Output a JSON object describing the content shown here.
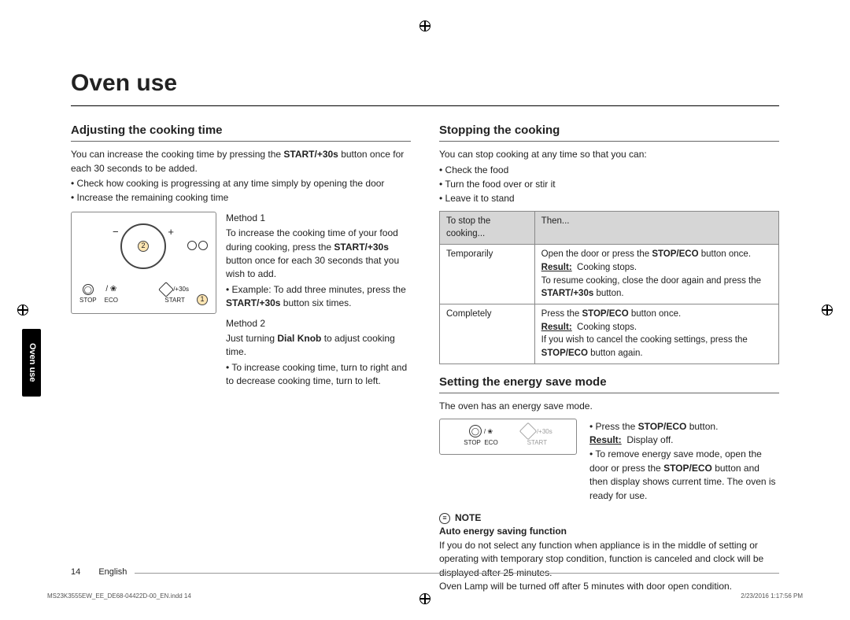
{
  "page_title": "Oven use",
  "side_tab": "Oven use",
  "left": {
    "heading": "Adjusting the cooking time",
    "intro_a": "You can increase the cooking time by pressing the ",
    "intro_bold": "START/+30s",
    "intro_b": " button once for each 30 seconds to be added.",
    "bullets": [
      "Check how cooking is progressing at any time simply by opening the door",
      "Increase the remaining cooking time"
    ],
    "diagram": {
      "stop_label": "STOP",
      "eco_label": "ECO",
      "start_label": "START",
      "plus30": "/+30s",
      "num1": "1",
      "num2": "2"
    },
    "m1_title": "Method 1",
    "m1_a": "To increase the cooking time of your food during cooking, press the ",
    "m1_bold1": "START/+30s",
    "m1_b": " button once for each 30 seconds that you wish to add.",
    "m1_ex_a": "Example: To add three minutes, press the ",
    "m1_ex_bold": "START/+30s",
    "m1_ex_b": " button six times.",
    "m2_title": "Method 2",
    "m2_a": "Just turning ",
    "m2_bold": "Dial Knob",
    "m2_b": " to adjust cooking time.",
    "m2_bullet": "To increase cooking time, turn to right and to decrease cooking time, turn to left."
  },
  "right": {
    "stop_heading": "Stopping the cooking",
    "stop_intro": "You can stop cooking at any time so that you can:",
    "stop_bullets": [
      "Check the food",
      "Turn the food over or stir it",
      "Leave it to stand"
    ],
    "th1": "To stop the cooking...",
    "th2": "Then...",
    "r1c1": "Temporarily",
    "r1_a": "Open the door or press the ",
    "r1_bold1": "STOP/ECO",
    "r1_b": " button once.",
    "result_label": "Result:",
    "r1_result": "Cooking stops.",
    "r1_c": "To resume cooking, close the door again and press the ",
    "r1_bold2": "START/+30s",
    "r1_d": " button.",
    "r2c1": "Completely",
    "r2_a": "Press the ",
    "r2_bold1": "STOP/ECO",
    "r2_b": " button once.",
    "r2_result": "Cooking stops.",
    "r2_c": "If you wish to cancel the cooking settings, press the ",
    "r2_bold2": "STOP/ECO",
    "r2_d": " button again.",
    "energy_heading": "Setting the energy save mode",
    "energy_intro": "The oven has an energy save mode.",
    "panel": {
      "stop": "STOP",
      "eco": "ECO",
      "start": "START",
      "plus30": "/+30s"
    },
    "energy_b1_a": "Press the ",
    "energy_b1_bold": "STOP/ECO",
    "energy_b1_b": " button.",
    "energy_b1_res": "Display off.",
    "energy_b2_a": "To remove energy save mode, open the door or press the ",
    "energy_b2_bold": "STOP/ECO",
    "energy_b2_b": " button and then display shows current time. The oven is ready for use.",
    "note_label": "NOTE",
    "note_sub": "Auto energy saving function",
    "note_p1": "If you do not select any function when appliance is in the middle of setting or operating with temporary stop condition, function is canceled and clock will be displayed after 25 minutes.",
    "note_p2": "Oven Lamp will be turned off after 5 minutes with door open condition."
  },
  "footer": {
    "page_num": "14",
    "lang": "English"
  },
  "print": {
    "left": "MS23K3555EW_EE_DE68-04422D-00_EN.indd   14",
    "right": "2/23/2016   1:17:56 PM"
  }
}
